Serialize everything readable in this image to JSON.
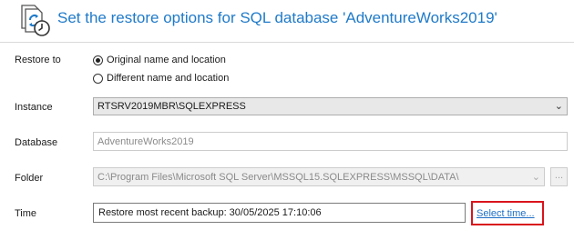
{
  "header": {
    "title": "Set the restore options for SQL database 'AdventureWorks2019'",
    "icon": "restore-database-icon"
  },
  "form": {
    "restore_to": {
      "label": "Restore to",
      "options": [
        {
          "label": "Original name and location",
          "checked": true
        },
        {
          "label": "Different name and location",
          "checked": false
        }
      ]
    },
    "instance": {
      "label": "Instance",
      "value": "RTSRV2019MBR\\SQLEXPRESS"
    },
    "database": {
      "label": "Database",
      "value": "AdventureWorks2019"
    },
    "folder": {
      "label": "Folder",
      "value": "C:\\Program Files\\Microsoft SQL Server\\MSSQL15.SQLEXPRESS\\MSSQL\\DATA\\",
      "browse_label": "..."
    },
    "time": {
      "label": "Time",
      "value": "Restore most recent backup: 30/05/2025 17:10:06",
      "select_link": "Select time..."
    }
  },
  "colors": {
    "accent": "#1f7ac9",
    "highlight": "#d9141c",
    "link": "#1f6fc5"
  }
}
